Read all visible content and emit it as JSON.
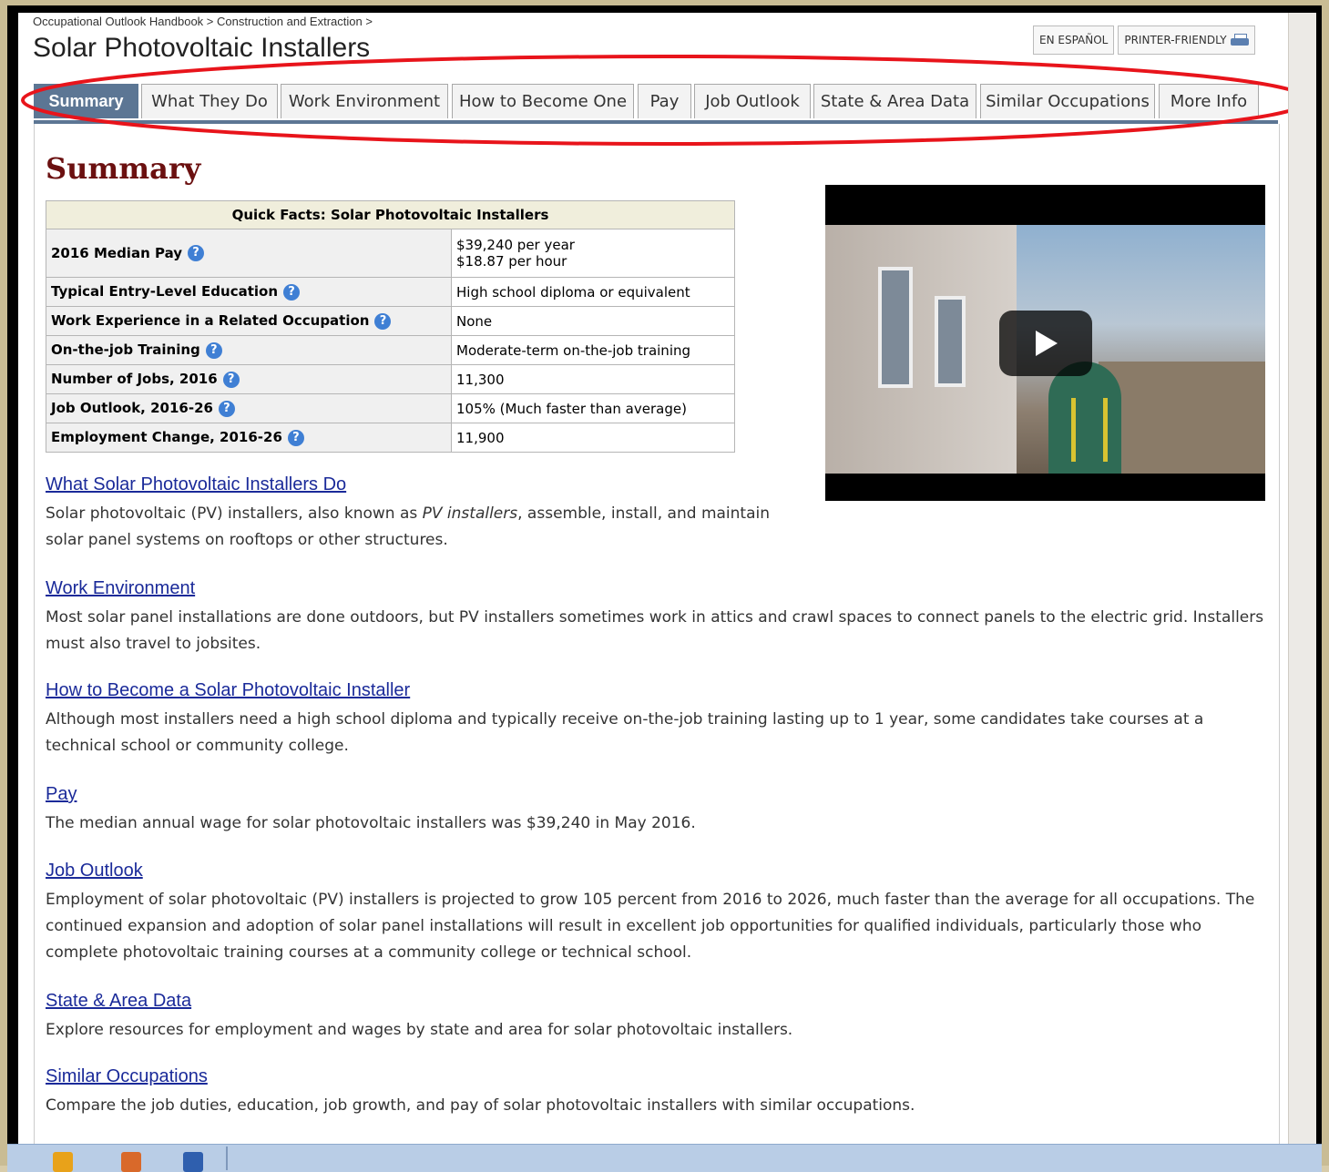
{
  "breadcrumb": {
    "part1": "Occupational Outlook Handbook",
    "sep1": " > ",
    "part2": "Construction and Extraction",
    "sep2": " >"
  },
  "page_title": "Solar Photovoltaic Installers",
  "top_buttons": {
    "spanish": "EN ESPAÑOL",
    "printer": "PRINTER-FRIENDLY"
  },
  "tabs": [
    "Summary",
    "What They Do",
    "Work Environment",
    "How to Become One",
    "Pay",
    "Job Outlook",
    "State & Area Data",
    "Similar Occupations",
    "More Info"
  ],
  "summary_heading": "Summary",
  "quick_facts": {
    "title": "Quick Facts: Solar Photovoltaic Installers",
    "rows": [
      {
        "label": "2016 Median Pay",
        "value1": "$39,240 per year",
        "value2": "$18.87 per hour"
      },
      {
        "label": "Typical Entry-Level Education",
        "value1": "High school diploma or equivalent"
      },
      {
        "label": "Work Experience in a Related Occupation",
        "value1": "None"
      },
      {
        "label": "On-the-job Training",
        "value1": "Moderate-term on-the-job training"
      },
      {
        "label": "Number of Jobs, 2016",
        "value1": "11,300"
      },
      {
        "label": "Job Outlook, 2016-26",
        "value1": "105% (Much faster than average)"
      },
      {
        "label": "Employment Change, 2016-26",
        "value1": "11,900"
      }
    ],
    "help_glyph": "?"
  },
  "sections": {
    "what_they_do": {
      "heading": "What Solar Photovoltaic Installers Do",
      "text_before": "Solar photovoltaic (PV) installers, also known as ",
      "text_em": "PV installers",
      "text_after": ", assemble, install, and maintain solar panel systems on rooftops or other structures."
    },
    "work_env": {
      "heading": "Work Environment",
      "text": "Most solar panel installations are done outdoors, but PV installers sometimes work in attics and crawl spaces to connect panels to the electric grid. Installers must also travel to jobsites."
    },
    "how_to_become": {
      "heading": "How to Become a Solar Photovoltaic Installer",
      "text": "Although most installers need a high school diploma and typically receive on-the-job training lasting up to 1 year, some candidates take courses at a technical school or community college."
    },
    "pay": {
      "heading": "Pay",
      "text": "The median annual wage for solar photovoltaic installers was $39,240 in May 2016."
    },
    "job_outlook": {
      "heading": "Job Outlook",
      "text": "Employment of solar photovoltaic (PV) installers is projected to grow 105 percent from 2016 to 2026, much faster than the average for all occupations. The continued expansion and adoption of solar panel installations will result in excellent job opportunities for qualified individuals, particularly those who complete photovoltaic training courses at a community college or technical school."
    },
    "state_area": {
      "heading": "State & Area Data",
      "text": "Explore resources for employment and wages by state and area for solar photovoltaic installers."
    },
    "similar": {
      "heading": "Similar Occupations",
      "text": "Compare the job duties, education, job growth, and pay of solar photovoltaic installers with similar occupations."
    }
  },
  "colors": {
    "tab_active": "#5c7694",
    "heading_red": "#6b1010",
    "link_blue": "#1a2a99",
    "annotation_red": "#e8141b"
  },
  "icons": {
    "help": "question-circle-icon",
    "printer": "printer-icon",
    "play": "play-icon",
    "taskbar": [
      "outlook-icon",
      "powerpoint-icon",
      "word-icon"
    ]
  }
}
